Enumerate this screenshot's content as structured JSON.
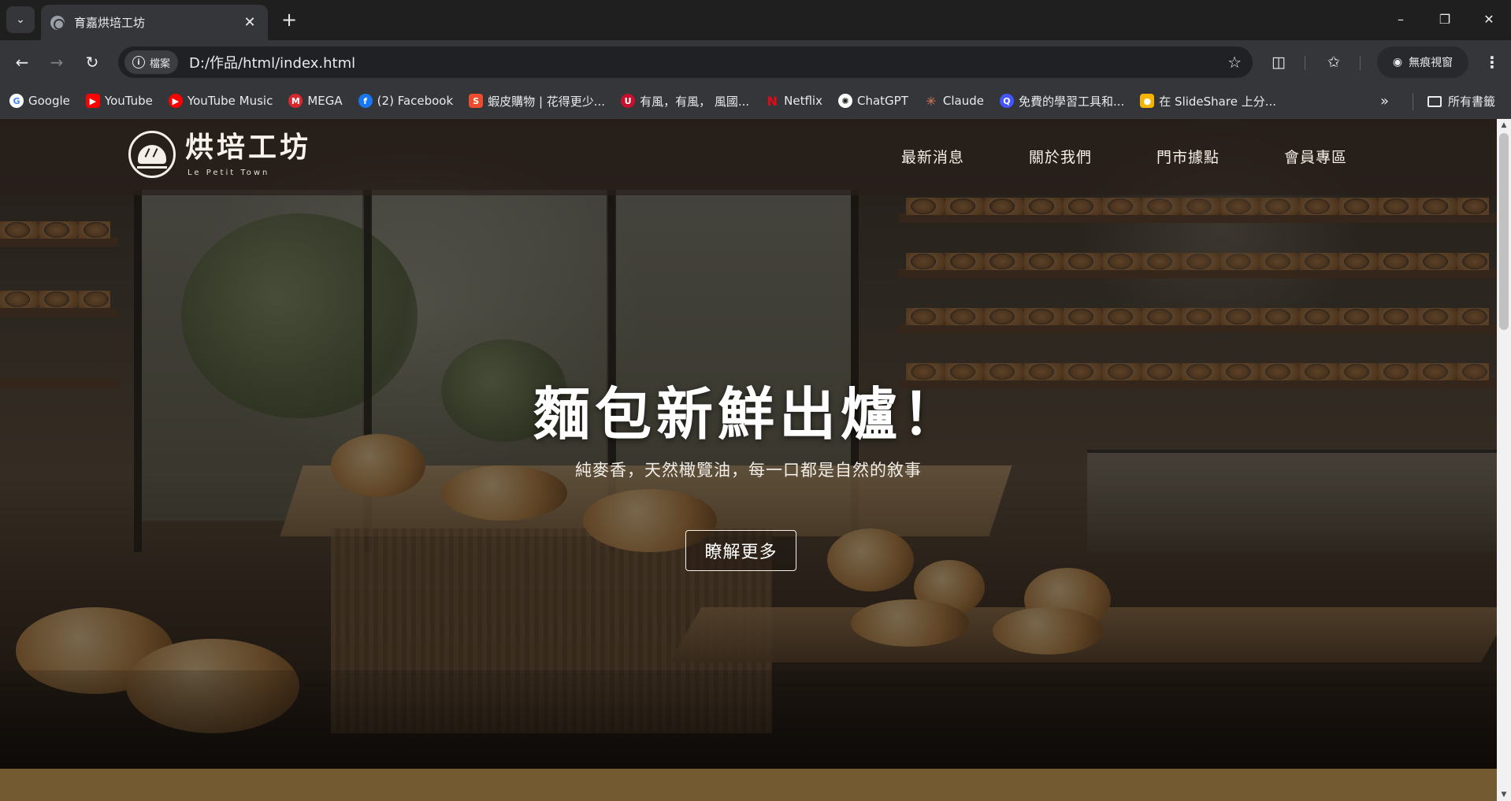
{
  "browser": {
    "tab": {
      "title": "育嘉烘培工坊"
    },
    "address": {
      "site_chip": "檔案",
      "url": "D:/作品/html/index.html"
    },
    "incognito_label": "無痕視窗",
    "bookmarks": [
      {
        "label": "Google",
        "icon": "google-icon",
        "color": "#4285f4"
      },
      {
        "label": "YouTube",
        "icon": "youtube-icon",
        "color": "#ff0000"
      },
      {
        "label": "YouTube Music",
        "icon": "youtube-music-icon",
        "color": "#ff0000"
      },
      {
        "label": "MEGA",
        "icon": "mega-icon",
        "color": "#d9272e"
      },
      {
        "label": "(2) Facebook",
        "icon": "facebook-icon",
        "color": "#1877f2"
      },
      {
        "label": "蝦皮購物 | 花得更少...",
        "icon": "shopee-icon",
        "color": "#ee4d2d"
      },
      {
        "label": "有風，有風， 風國...",
        "icon": "wind-icon",
        "color": "#c8102e"
      },
      {
        "label": "Netflix",
        "icon": "netflix-icon",
        "color": "#e50914"
      },
      {
        "label": "ChatGPT",
        "icon": "chatgpt-icon",
        "color": "#ffffff"
      },
      {
        "label": "Claude",
        "icon": "claude-icon",
        "color": "#d97757"
      },
      {
        "label": "免費的學習工具和...",
        "icon": "quizlet-icon",
        "color": "#4255ff"
      },
      {
        "label": "在 SlideShare 上分...",
        "icon": "slideshare-icon",
        "color": "#f4b400"
      }
    ],
    "all_bookmarks_label": "所有書籤"
  },
  "site": {
    "logo": {
      "title": "烘培工坊",
      "subtitle": "Le Petit Town"
    },
    "nav": [
      {
        "label": "最新消息"
      },
      {
        "label": "關於我們"
      },
      {
        "label": "門市據點"
      },
      {
        "label": "會員專區"
      }
    ],
    "hero": {
      "title": "麵包新鮮出爐！",
      "subtitle": "純麥香，天然橄覽油，每一口都是自然的敘事",
      "button_label": "瞭解更多"
    }
  },
  "colors": {
    "next_band": "#735a30",
    "header_bg": "#28201a"
  }
}
